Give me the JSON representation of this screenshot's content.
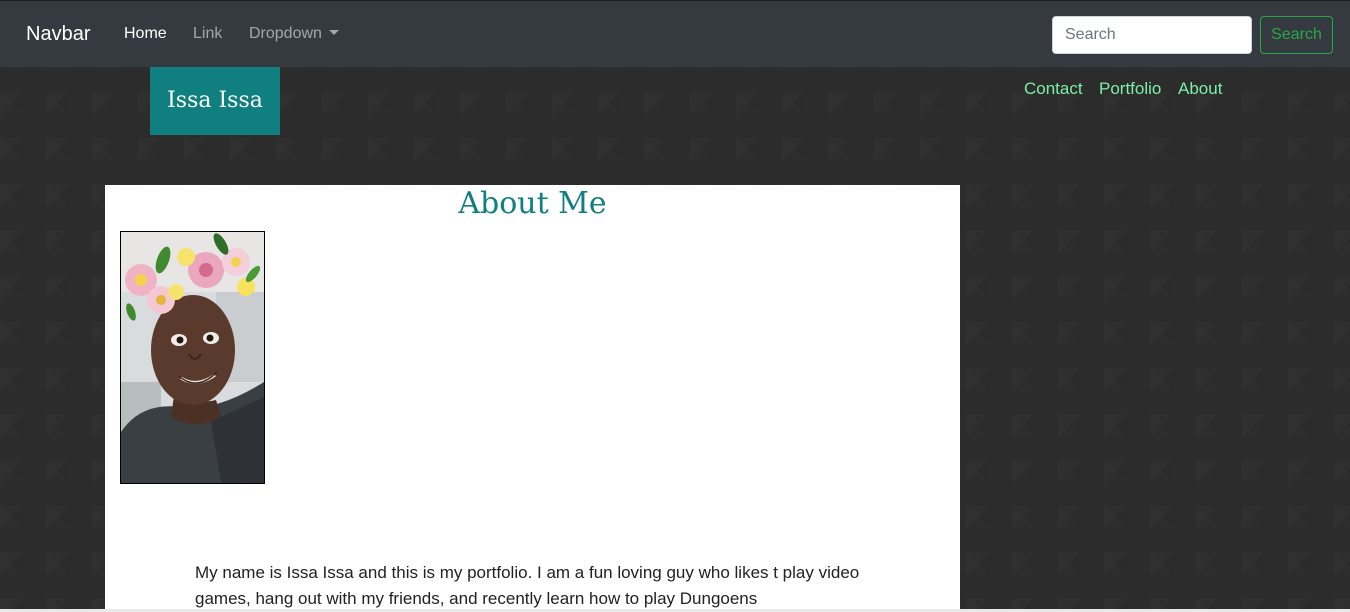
{
  "navbar": {
    "brand": "Navbar",
    "items": [
      {
        "label": "Home",
        "active": true
      },
      {
        "label": "Link",
        "active": false
      },
      {
        "label": "Dropdown",
        "active": false
      }
    ],
    "search": {
      "placeholder": "Search",
      "value": "",
      "button_label": "Search"
    }
  },
  "site": {
    "logo_text": "Issa Issa",
    "nav": [
      {
        "label": "Contact"
      },
      {
        "label": "Portfolio"
      },
      {
        "label": "About"
      }
    ]
  },
  "about": {
    "title": "About Me",
    "bio": "My name is Issa Issa and this is my portfolio. I am a fun loving guy who likes t play video games, hang out with my friends, and recently learn how to play Dungoens"
  },
  "colors": {
    "navbar_bg": "#343a40",
    "accent_teal": "#0f7f7f",
    "site_link_green": "#7cf0a4",
    "search_button_green": "#28a745"
  }
}
